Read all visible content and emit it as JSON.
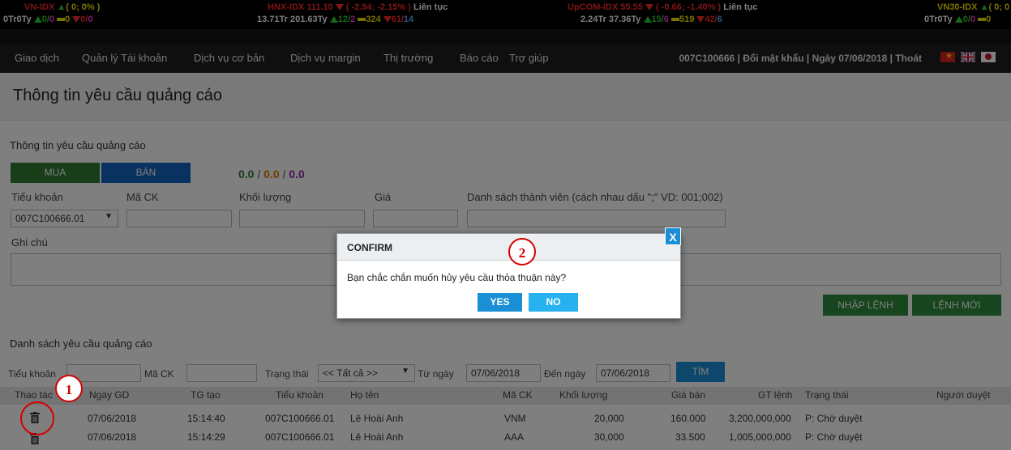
{
  "ticker": [
    {
      "name": "VN-IDX",
      "change": "0",
      "pct": "( 0; 0% )",
      "vol": "0Tr",
      "val": "0Ty",
      "up": "0/",
      "upb": "0",
      "eq": "0",
      "dn": "0/",
      "dnb": "0"
    },
    {
      "name": "HNX-IDX",
      "index": "111.10",
      "change": "( -2.94; -2.15% )",
      "status": "Liên tục",
      "vol": "13.71Tr",
      "val": "201.63Ty",
      "up": "12/",
      "upb": "2",
      "eq": "324",
      "dn": "61/",
      "dnb": "14"
    },
    {
      "name": "UpCOM-IDX",
      "index": "55.55",
      "change": "( -0.66; -1.40% )",
      "status": "Liên tục",
      "vol": "2.24Tr",
      "val": "37.36Ty",
      "up": "15/",
      "upb": "6",
      "eq": "519",
      "dn": "42/",
      "dnb": "6"
    },
    {
      "name": "VN30-IDX",
      "change": "( 0; 0",
      "vol": "0Tr",
      "val": "0Ty",
      "up": "0/",
      "upb": "0",
      "eq": "0"
    }
  ],
  "menu": [
    "Giao dịch",
    "Quản lý Tài khoản",
    "Dịch vụ cơ bản",
    "Dịch vụ margin",
    "Thị trường",
    "Báo cáo",
    "Trợ giúp"
  ],
  "account_bar": "007C100666 | Đổi mật khẩu | Ngày 07/06/2018 | Thoát",
  "page_title": "Thông tin yêu cầu quảng cáo",
  "form": {
    "section": "Thông tin yêu cầu quảng cáo",
    "buy": "MUA",
    "sell": "BÁN",
    "ratio_a": "0.0",
    "ratio_sep1": " / ",
    "ratio_b": "0.0",
    "ratio_sep2": " / ",
    "ratio_c": "0.0",
    "labels": {
      "sub": "Tiểu khoản",
      "code": "Mã CK",
      "qty": "Khối lượng",
      "price": "Giá",
      "members": "Danh sách thành viên (cách nhau dấu \";\" VD: 001;002)",
      "note": "Ghi chú"
    },
    "sub_value": "007C100666.01",
    "enter": "NHẬP LỆNH",
    "new": "LỆNH MỚI"
  },
  "list": {
    "section": "Danh sách yêu cầu quảng cáo",
    "filters": {
      "sub": "Tiểu khoản",
      "code": "Mã CK",
      "status": "Trạng thái",
      "status_value": "<< Tất cả >>",
      "from": "Từ ngày",
      "from_value": "07/06/2018",
      "to": "Đến ngày",
      "to_value": "07/06/2018",
      "search": "TÌM"
    },
    "headers": [
      "Thao tác",
      "Ngày GD",
      "TG tạo",
      "Tiểu khoản",
      "Họ tên",
      "Mã CK",
      "Khối lượng",
      "Giá bán",
      "GT lệnh",
      "Trạng thái",
      "Người duyệt"
    ],
    "rows": [
      [
        "07/06/2018",
        "15:14:40",
        "007C100666.01",
        "Lê Hoài Anh",
        "VNM",
        "20,000",
        "160.000",
        "3,200,000,000",
        "P: Chờ duyệt"
      ],
      [
        "07/06/2018",
        "15:14:29",
        "007C100666.01",
        "Lê Hoài Anh",
        "AAA",
        "30,000",
        "33.500",
        "1,005,000,000",
        "P: Chờ duyệt"
      ]
    ]
  },
  "modal": {
    "title": "CONFIRM",
    "message": "Bạn chắc chắn muốn hủy yêu cầu thỏa thuận này?",
    "yes": "YES",
    "no": "NO",
    "close": "X"
  },
  "markers": [
    "1",
    "2"
  ]
}
